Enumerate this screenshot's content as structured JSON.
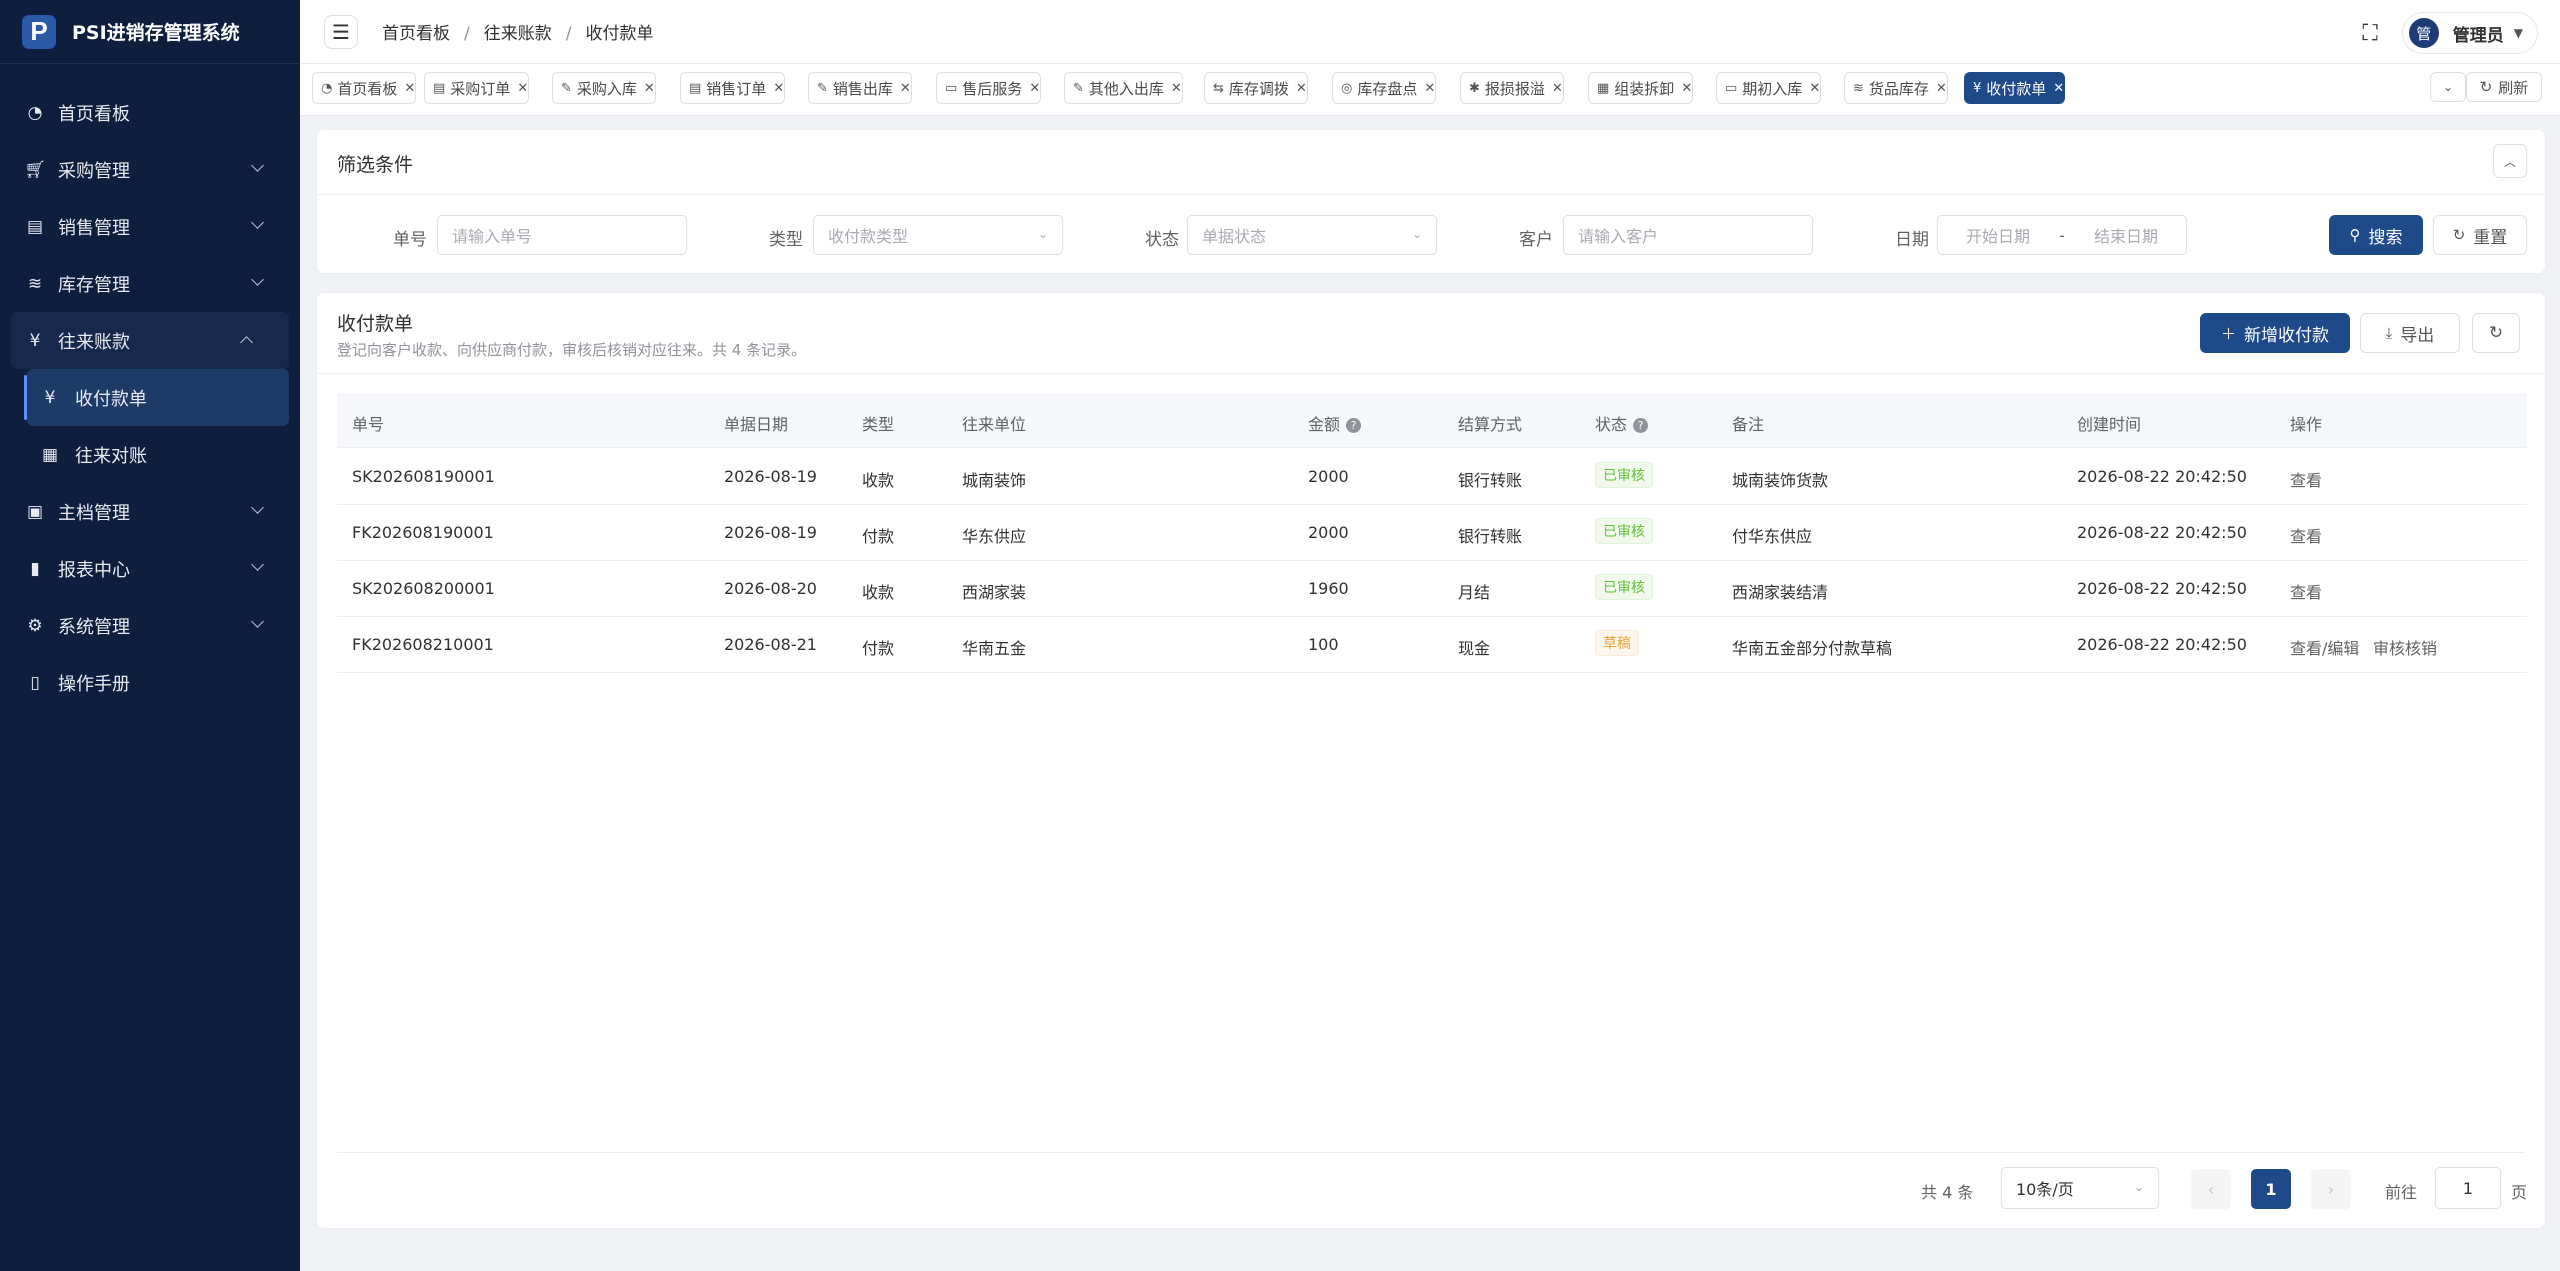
{
  "app": {
    "logo_letter": "P",
    "name": "PSI进销存管理系统"
  },
  "sidebar": {
    "items": [
      {
        "label": "首页看板",
        "icon": "dashboard-icon"
      },
      {
        "label": "采购管理",
        "icon": "cart-icon"
      },
      {
        "label": "销售管理",
        "icon": "sales-icon"
      },
      {
        "label": "库存管理",
        "icon": "layers-icon"
      },
      {
        "label": "往来账款",
        "icon": "yen-icon",
        "expanded": true,
        "children": [
          {
            "label": "收付款单",
            "icon": "yen-icon",
            "active": true
          },
          {
            "label": "往来对账",
            "icon": "document-icon"
          }
        ]
      },
      {
        "label": "主档管理",
        "icon": "archive-icon"
      },
      {
        "label": "报表中心",
        "icon": "bar-chart-icon"
      },
      {
        "label": "系统管理",
        "icon": "gear-icon"
      },
      {
        "label": "操作手册",
        "icon": "book-icon"
      }
    ]
  },
  "header": {
    "breadcrumb": [
      "首页看板",
      "往来账款",
      "收付款单"
    ],
    "user_name": "管理员",
    "avatar_text": "管"
  },
  "tabs": [
    {
      "label": "首页看板",
      "icon": "dashboard-icon"
    },
    {
      "label": "采购订单",
      "icon": "document-icon"
    },
    {
      "label": "采购入库",
      "icon": "edit-icon"
    },
    {
      "label": "销售订单",
      "icon": "document-icon"
    },
    {
      "label": "销售出库",
      "icon": "edit-icon"
    },
    {
      "label": "售后服务",
      "icon": "briefcase-icon"
    },
    {
      "label": "其他入出库",
      "icon": "edit-icon"
    },
    {
      "label": "库存调拨",
      "icon": "transfer-icon"
    },
    {
      "label": "库存盘点",
      "icon": "target-icon"
    },
    {
      "label": "报损报溢",
      "icon": "bug-icon"
    },
    {
      "label": "组装拆卸",
      "icon": "grid-icon"
    },
    {
      "label": "期初入库",
      "icon": "box-icon"
    },
    {
      "label": "货品库存",
      "icon": "layers-icon"
    },
    {
      "label": "收付款单",
      "icon": "yen-icon",
      "active": true
    }
  ],
  "tabs_actions": {
    "refresh_label": "刷新"
  },
  "filter": {
    "title": "筛选条件",
    "fields": {
      "order_no": {
        "label": "单号",
        "placeholder": "请输入单号"
      },
      "type": {
        "label": "类型",
        "placeholder": "收付款类型"
      },
      "status": {
        "label": "状态",
        "placeholder": "单据状态"
      },
      "customer": {
        "label": "客户",
        "placeholder": "请输入客户"
      },
      "date": {
        "label": "日期",
        "start_placeholder": "开始日期",
        "separator": "-",
        "end_placeholder": "结束日期"
      }
    },
    "search_label": "搜索",
    "reset_label": "重置"
  },
  "list": {
    "title": "收付款单",
    "description": "登记向客户收款、向供应商付款，审核后核销对应往来。共 4 条记录。",
    "add_label": "新增收付款",
    "export_label": "导出",
    "columns": [
      "单号",
      "单据日期",
      "类型",
      "往来单位",
      "金额",
      "结算方式",
      "状态",
      "备注",
      "创建时间",
      "操作"
    ],
    "rows": [
      {
        "no": "SK202608190001",
        "date": "2026-08-19",
        "type": "收款",
        "party": "城南装饰",
        "amount": "2000",
        "method": "银行转账",
        "status": "已审核",
        "status_kind": "ok",
        "remark": "城南装饰货款",
        "created": "2026-08-22 20:42:50",
        "actions": [
          "查看"
        ]
      },
      {
        "no": "FK202608190001",
        "date": "2026-08-19",
        "type": "付款",
        "party": "华东供应",
        "amount": "2000",
        "method": "银行转账",
        "status": "已审核",
        "status_kind": "ok",
        "remark": "付华东供应",
        "created": "2026-08-22 20:42:50",
        "actions": [
          "查看"
        ]
      },
      {
        "no": "SK202608200001",
        "date": "2026-08-20",
        "type": "收款",
        "party": "西湖家装",
        "amount": "1960",
        "method": "月结",
        "status": "已审核",
        "status_kind": "ok",
        "remark": "西湖家装结清",
        "created": "2026-08-22 20:42:50",
        "actions": [
          "查看"
        ]
      },
      {
        "no": "FK202608210001",
        "date": "2026-08-21",
        "type": "付款",
        "party": "华南五金",
        "amount": "100",
        "method": "现金",
        "status": "草稿",
        "status_kind": "draft",
        "remark": "华南五金部分付款草稿",
        "created": "2026-08-22 20:42:50",
        "actions": [
          "查看/编辑",
          "审核核销"
        ]
      }
    ]
  },
  "pagination": {
    "total_text": "共 4 条",
    "page_size": "10条/页",
    "current_page": "1",
    "goto_label": "前往",
    "goto_value": "1",
    "page_unit": "页"
  }
}
